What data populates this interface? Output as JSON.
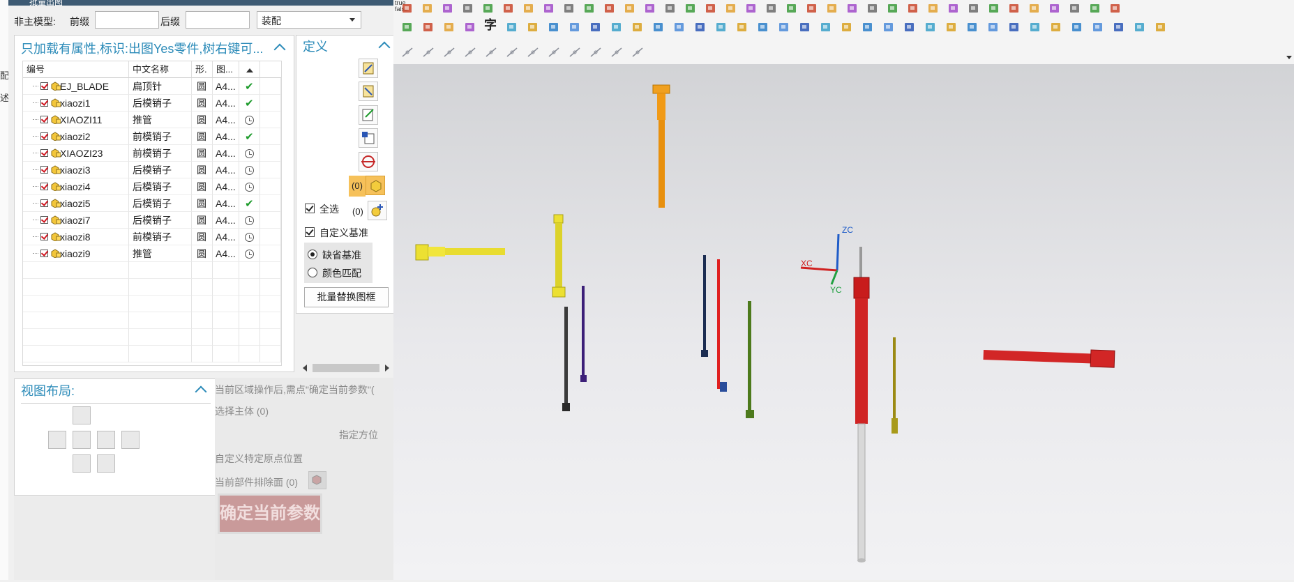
{
  "dialog": {
    "title": "批量出图",
    "non_main_model_label": "非主模型:",
    "prefix_label": "前缀",
    "prefix_value": "",
    "suffix_label": "后缀",
    "suffix_value": "",
    "mode_select_value": "装配"
  },
  "part_list": {
    "header": "只加载有属性,标识:出图Yes零件,树右键可...",
    "columns": [
      "编号",
      "中文名称",
      "形.",
      "图..."
    ],
    "rows": [
      {
        "id": "EJ_BLADE",
        "name": "扁顶针",
        "shape": "圆",
        "sheet": "A4...",
        "status": "ok"
      },
      {
        "id": "xiaozi1",
        "name": "后模销子",
        "shape": "圆",
        "sheet": "A4...",
        "status": "ok"
      },
      {
        "id": "XIAOZI11",
        "name": "推管",
        "shape": "圆",
        "sheet": "A4...",
        "status": "pending"
      },
      {
        "id": "xiaozi2",
        "name": "前模销子",
        "shape": "圆",
        "sheet": "A4...",
        "status": "ok"
      },
      {
        "id": "XIAOZI23",
        "name": "前模销子",
        "shape": "圆",
        "sheet": "A4...",
        "status": "pending"
      },
      {
        "id": "xiaozi3",
        "name": "后模销子",
        "shape": "圆",
        "sheet": "A4...",
        "status": "pending"
      },
      {
        "id": "xiaozi4",
        "name": "后模销子",
        "shape": "圆",
        "sheet": "A4...",
        "status": "pending"
      },
      {
        "id": "xiaozi5",
        "name": "后模销子",
        "shape": "圆",
        "sheet": "A4...",
        "status": "ok"
      },
      {
        "id": "xiaozi7",
        "name": "后模销子",
        "shape": "圆",
        "sheet": "A4...",
        "status": "pending"
      },
      {
        "id": "xiaozi8",
        "name": "前模销子",
        "shape": "圆",
        "sheet": "A4...",
        "status": "pending"
      },
      {
        "id": "xiaozi9",
        "name": "推管",
        "shape": "圆",
        "sheet": "A4...",
        "status": "pending"
      }
    ]
  },
  "define_panel": {
    "title": "定义",
    "count_a": "(0)",
    "count_b": "(0)",
    "select_all_label": "全选",
    "custom_datum_label": "自定义基准",
    "radio_default_label": "缺省基准",
    "radio_color_label": "颜色匹配",
    "replace_frame_button": "批量替换图框"
  },
  "view_layout": {
    "title": "视图布局:"
  },
  "params": {
    "hint_text": "当前区域操作后,需点\"确定当前参数\"(",
    "select_body": "选择主体 (0)",
    "specify_orientation": "指定方位",
    "custom_origin": "自定义特定原点位置",
    "exclude_faces": "当前部件排除面 (0)",
    "confirm_button": "确定当前参数"
  },
  "toolbar": {
    "true_false_label": "true false",
    "text_tool_label": "字"
  },
  "viewport": {
    "axis_zc": "ZC",
    "axis_xc": "XC",
    "axis_yc": "YC"
  }
}
